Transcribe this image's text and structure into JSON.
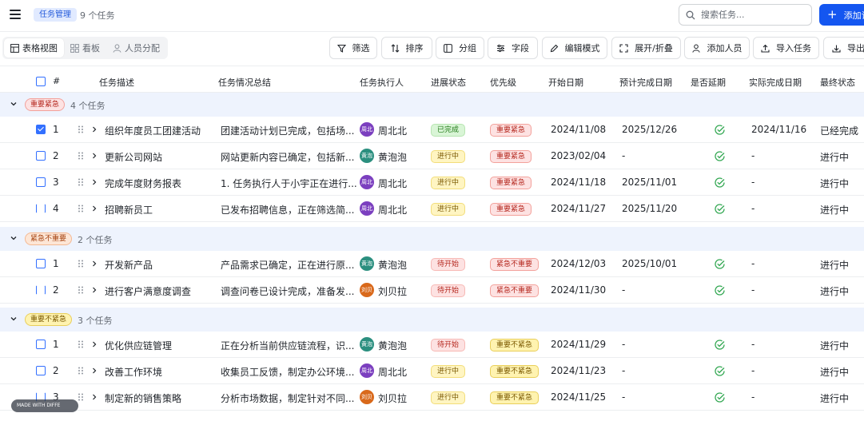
{
  "header": {
    "title_tag": "任务管理",
    "task_count": "9 个任务",
    "search_placeholder": "搜索任务...",
    "add_button_label": "添加记",
    "brand_color": "#1456f0"
  },
  "views": [
    {
      "label": "表格视图",
      "icon": "table-icon",
      "active": true
    },
    {
      "label": "看板",
      "icon": "kanban-icon",
      "active": false
    },
    {
      "label": "人员分配",
      "icon": "person-icon",
      "active": false
    }
  ],
  "toolbar": {
    "filter": "筛选",
    "sort": "排序",
    "group": "分组",
    "fields": "字段",
    "edit_mode": "编辑模式",
    "expand_collapse": "展开/折叠",
    "add_member": "添加人员",
    "import": "导入任务",
    "export": "导出"
  },
  "columns": {
    "num": "#",
    "desc": "任务描述",
    "summary": "任务情况总结",
    "assignee": "任务执行人",
    "progress": "进展状态",
    "priority": "优先级",
    "start": "开始日期",
    "expected": "预计完成日期",
    "delayed": "是否延期",
    "actual": "实际完成日期",
    "final": "最终状态"
  },
  "groups": [
    {
      "label": "重要紧急",
      "count": "4 个任务",
      "tag_bg": "#fde2e2",
      "tag_color": "#b5281f",
      "tag_border": "#f3a19b",
      "rows": [
        {
          "num": "1",
          "desc": "组织年度员工团建活动",
          "summary": "团建活动计划已完成，包括场...",
          "avatar": "周北北",
          "avatar_color": "#7b3fbf",
          "assignee": "周北北",
          "progress": "已完成",
          "priority": "重要紧急",
          "start": "2024/11/08",
          "expected": "2025/12/26",
          "actual": "2024/11/16",
          "final": "已经完成"
        },
        {
          "num": "2",
          "desc": "更新公司网站",
          "summary": "网站更新内容已确定，包括新...",
          "avatar": "黄泡泡",
          "avatar_color": "#2b8f7f",
          "assignee": "黄泡泡",
          "progress": "进行中",
          "priority": "重要紧急",
          "start": "2023/02/04",
          "expected": "-",
          "actual": "-",
          "final": "进行中"
        },
        {
          "num": "3",
          "desc": "完成年度财务报表",
          "summary": "1. 任务执行人于小宇正在进行...",
          "avatar": "周北北",
          "avatar_color": "#7b3fbf",
          "assignee": "周北北",
          "progress": "进行中",
          "priority": "重要紧急",
          "start": "2024/11/18",
          "expected": "2025/11/01",
          "actual": "-",
          "final": "进行中"
        },
        {
          "num": "4",
          "desc": "招聘新员工",
          "summary": "已发布招聘信息，正在筛选简...",
          "avatar": "周北北",
          "avatar_color": "#7b3fbf",
          "assignee": "周北北",
          "progress": "进行中",
          "priority": "重要紧急",
          "start": "2024/11/27",
          "expected": "2025/11/20",
          "actual": "-",
          "final": "进行中"
        }
      ]
    },
    {
      "label": "紧急不重要",
      "count": "2 个任务",
      "tag_bg": "#fde6d6",
      "tag_color": "#a5400d",
      "tag_border": "#f4b993",
      "rows": [
        {
          "num": "1",
          "desc": "开发新产品",
          "summary": "产品需求已确定，正在进行原...",
          "avatar": "黄泡泡",
          "avatar_color": "#2b8f7f",
          "assignee": "黄泡泡",
          "progress": "待开始",
          "priority": "紧急不重要",
          "start": "2024/12/03",
          "expected": "2025/10/01",
          "actual": "-",
          "final": "进行中"
        },
        {
          "num": "2",
          "desc": "进行客户满意度调查",
          "summary": "调查问卷已设计完成，准备发...",
          "avatar": "刘贝拉",
          "avatar_color": "#d9691b",
          "assignee": "刘贝拉",
          "progress": "待开始",
          "priority": "紧急不重要",
          "start": "2024/11/30",
          "expected": "-",
          "actual": "-",
          "final": "进行中"
        }
      ]
    },
    {
      "label": "重要不紧急",
      "count": "3 个任务",
      "tag_bg": "#fff3b0",
      "tag_color": "#7a5800",
      "tag_border": "#e9cf5b",
      "rows": [
        {
          "num": "1",
          "desc": "优化供应链管理",
          "summary": "正在分析当前供应链流程，识...",
          "avatar": "黄泡泡",
          "avatar_color": "#2b8f7f",
          "assignee": "黄泡泡",
          "progress": "待开始",
          "priority": "重要不紧急",
          "start": "2024/11/29",
          "expected": "-",
          "actual": "-",
          "final": "进行中"
        },
        {
          "num": "2",
          "desc": "改善工作环境",
          "summary": "收集员工反馈，制定办公环境...",
          "avatar": "周北北",
          "avatar_color": "#7b3fbf",
          "assignee": "周北北",
          "progress": "进行中",
          "priority": "重要不紧急",
          "start": "2024/11/23",
          "expected": "-",
          "actual": "-",
          "final": "进行中"
        },
        {
          "num": "3",
          "desc": "制定新的销售策略",
          "summary": "分析市场数据，制定针对不同...",
          "avatar": "刘贝拉",
          "avatar_color": "#d9691b",
          "assignee": "刘贝拉",
          "progress": "进行中",
          "priority": "重要不紧急",
          "start": "2024/11/25",
          "expected": "-",
          "actual": "-",
          "final": "进行中"
        }
      ]
    }
  ],
  "watermark": "MADE WITH DIFFE"
}
